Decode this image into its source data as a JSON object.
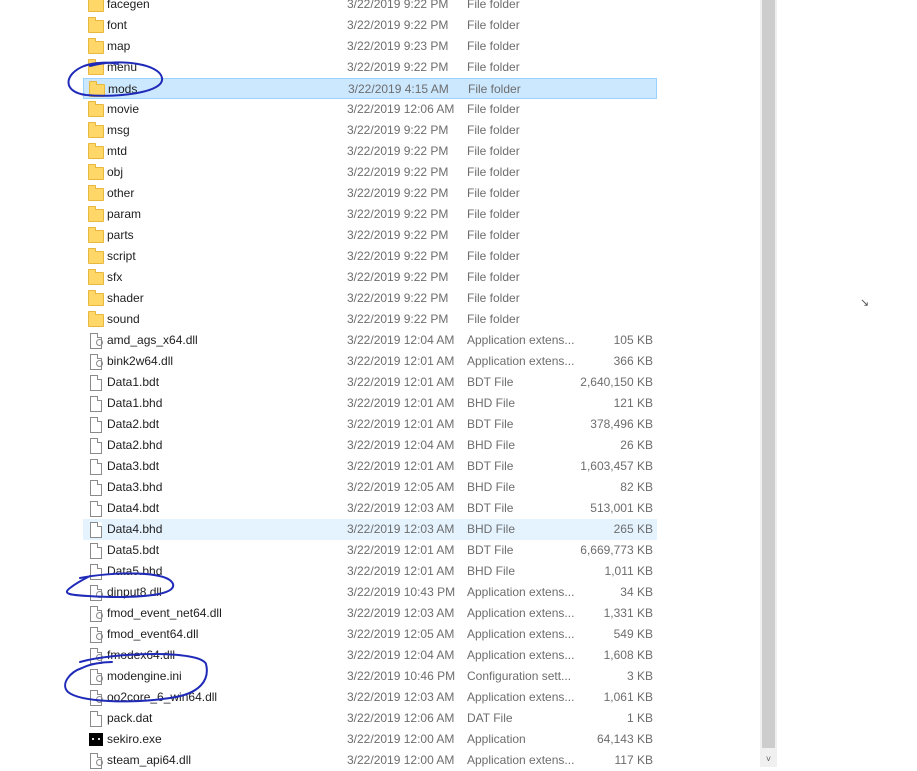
{
  "files": [
    {
      "name": "facegen",
      "date": "3/22/2019 9:22 PM",
      "type": "File folder",
      "size": "",
      "icon": "folder-icon"
    },
    {
      "name": "font",
      "date": "3/22/2019 9:22 PM",
      "type": "File folder",
      "size": "",
      "icon": "folder-icon"
    },
    {
      "name": "map",
      "date": "3/22/2019 9:23 PM",
      "type": "File folder",
      "size": "",
      "icon": "folder-icon"
    },
    {
      "name": "menu",
      "date": "3/22/2019 9:22 PM",
      "type": "File folder",
      "size": "",
      "icon": "folder-icon"
    },
    {
      "name": "mods",
      "date": "3/22/2019 4:15 AM",
      "type": "File folder",
      "size": "",
      "icon": "folder-icon",
      "state": "selected"
    },
    {
      "name": "movie",
      "date": "3/22/2019 12:06 AM",
      "type": "File folder",
      "size": "",
      "icon": "folder-icon"
    },
    {
      "name": "msg",
      "date": "3/22/2019 9:22 PM",
      "type": "File folder",
      "size": "",
      "icon": "folder-icon"
    },
    {
      "name": "mtd",
      "date": "3/22/2019 9:22 PM",
      "type": "File folder",
      "size": "",
      "icon": "folder-icon"
    },
    {
      "name": "obj",
      "date": "3/22/2019 9:22 PM",
      "type": "File folder",
      "size": "",
      "icon": "folder-icon"
    },
    {
      "name": "other",
      "date": "3/22/2019 9:22 PM",
      "type": "File folder",
      "size": "",
      "icon": "folder-icon"
    },
    {
      "name": "param",
      "date": "3/22/2019 9:22 PM",
      "type": "File folder",
      "size": "",
      "icon": "folder-icon"
    },
    {
      "name": "parts",
      "date": "3/22/2019 9:22 PM",
      "type": "File folder",
      "size": "",
      "icon": "folder-icon"
    },
    {
      "name": "script",
      "date": "3/22/2019 9:22 PM",
      "type": "File folder",
      "size": "",
      "icon": "folder-icon"
    },
    {
      "name": "sfx",
      "date": "3/22/2019 9:22 PM",
      "type": "File folder",
      "size": "",
      "icon": "folder-icon"
    },
    {
      "name": "shader",
      "date": "3/22/2019 9:22 PM",
      "type": "File folder",
      "size": "",
      "icon": "folder-icon"
    },
    {
      "name": "sound",
      "date": "3/22/2019 9:22 PM",
      "type": "File folder",
      "size": "",
      "icon": "folder-icon"
    },
    {
      "name": "amd_ags_x64.dll",
      "date": "3/22/2019 12:04 AM",
      "type": "Application extens...",
      "size": "105 KB",
      "icon": "dll-file-icon"
    },
    {
      "name": "bink2w64.dll",
      "date": "3/22/2019 12:01 AM",
      "type": "Application extens...",
      "size": "366 KB",
      "icon": "dll-file-icon"
    },
    {
      "name": "Data1.bdt",
      "date": "3/22/2019 12:01 AM",
      "type": "BDT File",
      "size": "2,640,150 KB",
      "icon": "file-icon"
    },
    {
      "name": "Data1.bhd",
      "date": "3/22/2019 12:01 AM",
      "type": "BHD File",
      "size": "121 KB",
      "icon": "file-icon"
    },
    {
      "name": "Data2.bdt",
      "date": "3/22/2019 12:01 AM",
      "type": "BDT File",
      "size": "378,496 KB",
      "icon": "file-icon"
    },
    {
      "name": "Data2.bhd",
      "date": "3/22/2019 12:04 AM",
      "type": "BHD File",
      "size": "26 KB",
      "icon": "file-icon"
    },
    {
      "name": "Data3.bdt",
      "date": "3/22/2019 12:01 AM",
      "type": "BDT File",
      "size": "1,603,457 KB",
      "icon": "file-icon"
    },
    {
      "name": "Data3.bhd",
      "date": "3/22/2019 12:05 AM",
      "type": "BHD File",
      "size": "82 KB",
      "icon": "file-icon"
    },
    {
      "name": "Data4.bdt",
      "date": "3/22/2019 12:03 AM",
      "type": "BDT File",
      "size": "513,001 KB",
      "icon": "file-icon"
    },
    {
      "name": "Data4.bhd",
      "date": "3/22/2019 12:03 AM",
      "type": "BHD File",
      "size": "265 KB",
      "icon": "file-icon",
      "state": "hover"
    },
    {
      "name": "Data5.bdt",
      "date": "3/22/2019 12:01 AM",
      "type": "BDT File",
      "size": "6,669,773 KB",
      "icon": "file-icon"
    },
    {
      "name": "Data5.bhd",
      "date": "3/22/2019 12:01 AM",
      "type": "BHD File",
      "size": "1,011 KB",
      "icon": "file-icon"
    },
    {
      "name": "dinput8.dll",
      "date": "3/22/2019 10:43 PM",
      "type": "Application extens...",
      "size": "34 KB",
      "icon": "dll-file-icon"
    },
    {
      "name": "fmod_event_net64.dll",
      "date": "3/22/2019 12:03 AM",
      "type": "Application extens...",
      "size": "1,331 KB",
      "icon": "dll-file-icon"
    },
    {
      "name": "fmod_event64.dll",
      "date": "3/22/2019 12:05 AM",
      "type": "Application extens...",
      "size": "549 KB",
      "icon": "dll-file-icon"
    },
    {
      "name": "fmodex64.dll",
      "date": "3/22/2019 12:04 AM",
      "type": "Application extens...",
      "size": "1,608 KB",
      "icon": "dll-file-icon"
    },
    {
      "name": "modengine.ini",
      "date": "3/22/2019 10:46 PM",
      "type": "Configuration sett...",
      "size": "3 KB",
      "icon": "ini-file-icon"
    },
    {
      "name": "oo2core_6_win64.dll",
      "date": "3/22/2019 12:03 AM",
      "type": "Application extens...",
      "size": "1,061 KB",
      "icon": "dll-file-icon"
    },
    {
      "name": "pack.dat",
      "date": "3/22/2019 12:06 AM",
      "type": "DAT File",
      "size": "1 KB",
      "icon": "file-icon"
    },
    {
      "name": "sekiro.exe",
      "date": "3/22/2019 12:00 AM",
      "type": "Application",
      "size": "64,143 KB",
      "icon": "exe-icon"
    },
    {
      "name": "steam_api64.dll",
      "date": "3/22/2019 12:00 AM",
      "type": "Application extens...",
      "size": "117 KB",
      "icon": "dll-file-icon"
    }
  ],
  "colors": {
    "selected_bg": "#cce8ff",
    "hover_bg": "#e5f3ff",
    "annotation_ink": "#1f2bb8"
  },
  "annotations": [
    {
      "circles": "mods"
    },
    {
      "circles": "dinput8.dll"
    },
    {
      "circles": "modengine.ini"
    },
    {
      "circles": "oo2core_6_win64.dll"
    }
  ],
  "scrollbar": {
    "down_arrow": "˅"
  }
}
